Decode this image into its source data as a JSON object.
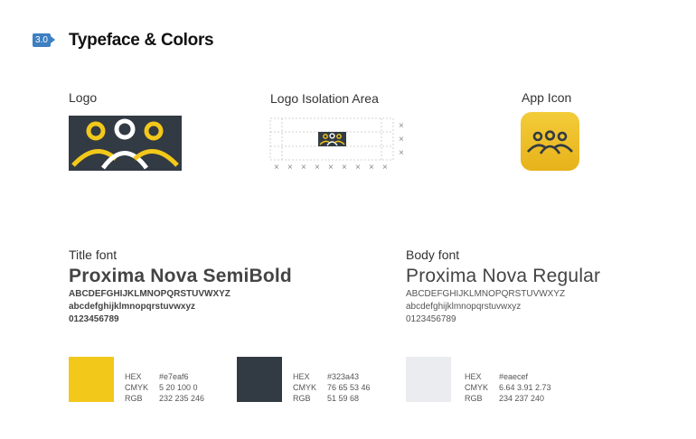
{
  "header": {
    "section_number": "3.0",
    "title": "Typeface & Colors"
  },
  "logos": {
    "logo_label": "Logo",
    "isolation_label": "Logo Isolation Area",
    "app_icon_label": "App Icon",
    "isolation_marker": "×"
  },
  "fonts": [
    {
      "label": "Title font",
      "name": "Proxima Nova SemiBold",
      "uppercase": "ABCDEFGHIJKLMNOPQRSTUVWXYZ",
      "lowercase": "abcdefghijklmnopqrstuvwxyz",
      "digits": "0123456789"
    },
    {
      "label": "Body font",
      "name": "Proxima Nova Regular",
      "uppercase": "ABCDEFGHIJKLMNOPQRSTUVWXYZ",
      "lowercase": "abcdefghijklmnopqrstuvwxyz",
      "digits": "0123456789"
    }
  ],
  "colors": [
    {
      "swatch": "#f2c81a",
      "hex_label": "HEX",
      "hex": "#e7eaf6",
      "cmyk_label": "CMYK",
      "cmyk": "5 20 100 0",
      "rgb_label": "RGB",
      "rgb": "232 235 246"
    },
    {
      "swatch": "#323a43",
      "hex_label": "HEX",
      "hex": "#323a43",
      "cmyk_label": "CMYK",
      "cmyk": "76 65 53 46",
      "rgb_label": "RGB",
      "rgb": "51 59 68"
    },
    {
      "swatch": "#eaecef",
      "hex_label": "HEX",
      "hex": "#eaecef",
      "cmyk_label": "CMYK",
      "cmyk": "6.64 3.91 2.73",
      "rgb_label": "RGB",
      "rgb": "234 237 240"
    }
  ],
  "brand_colors": {
    "yellow": "#f2c81a",
    "dark": "#323a43",
    "white": "#ffffff",
    "badge": "#3d7fc1"
  }
}
